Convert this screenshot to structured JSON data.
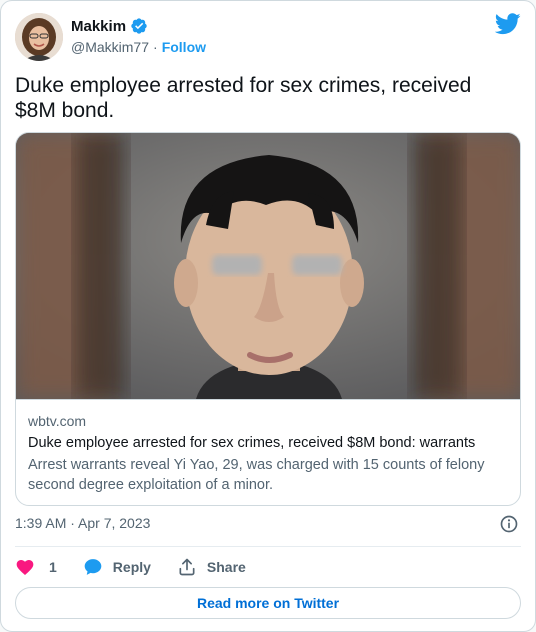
{
  "author": {
    "display_name": "Makkim",
    "handle": "@Makkim77",
    "separator": "·",
    "follow_label": "Follow"
  },
  "tweet": {
    "text": "Duke employee arrested for sex crimes, received $8M bond."
  },
  "card": {
    "domain": "wbtv.com",
    "title": "Duke employee arrested for sex crimes, received $8M bond: warrants",
    "description": "Arrest warrants reveal Yi Yao, 29, was charged with 15 counts of felony second degree exploitation of a minor."
  },
  "meta": {
    "timestamp": "1:39 AM · Apr 7, 2023"
  },
  "actions": {
    "like_count": "1",
    "reply_label": "Reply",
    "share_label": "Share"
  },
  "footer": {
    "read_more_label": "Read more on Twitter"
  },
  "colors": {
    "accent": "#1d9bf0",
    "like": "#f91880",
    "link": "#006fd6",
    "muted": "#536471"
  },
  "icons": [
    "verified-badge-icon",
    "twitter-bird-icon",
    "info-icon",
    "heart-icon",
    "reply-bubble-icon",
    "share-icon"
  ]
}
